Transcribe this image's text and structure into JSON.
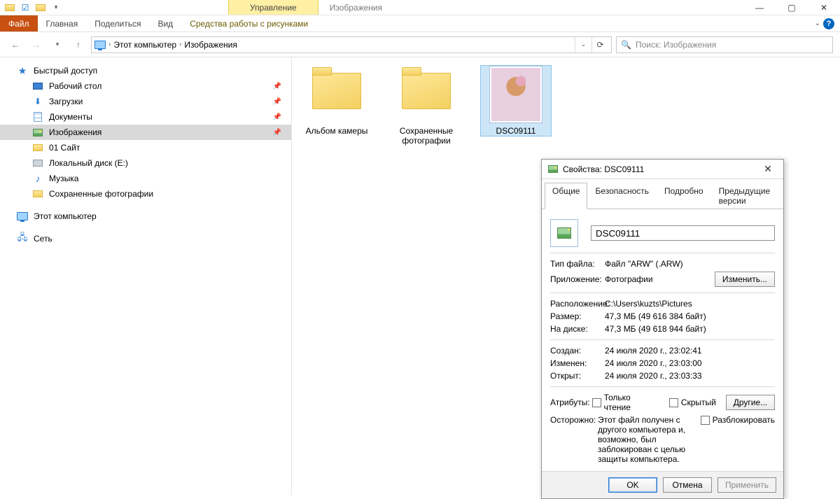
{
  "titlebar": {
    "manage": "Управление",
    "title": "Изображения"
  },
  "ribbon": {
    "file": "Файл",
    "home": "Главная",
    "share": "Поделиться",
    "view": "Вид",
    "picture_tools": "Средства работы с рисунками"
  },
  "breadcrumbs": {
    "this_pc": "Этот компьютер",
    "pictures": "Изображения"
  },
  "search": {
    "placeholder": "Поиск: Изображения"
  },
  "nav": {
    "quick_access": "Быстрый доступ",
    "desktop": "Рабочий стол",
    "downloads": "Загрузки",
    "documents": "Документы",
    "pictures": "Изображения",
    "site01": "01 Сайт",
    "local_disk": "Локальный диск (E:)",
    "music": "Музыка",
    "saved_photos": "Сохраненные фотографии",
    "this_pc": "Этот компьютер",
    "network": "Сеть"
  },
  "items": {
    "camera_roll": "Альбом камеры",
    "saved_photos": "Сохраненные фотографии",
    "dsc": "DSC09111"
  },
  "dialog": {
    "title": "Свойства: DSC09111",
    "tabs": {
      "general": "Общие",
      "security": "Безопасность",
      "details": "Подробно",
      "previous": "Предыдущие версии"
    },
    "filename": "DSC09111",
    "labels": {
      "filetype": "Тип файла:",
      "app": "Приложение:",
      "location": "Расположение:",
      "size": "Размер:",
      "on_disk": "На диске:",
      "created": "Создан:",
      "modified": "Изменен:",
      "accessed": "Открыт:",
      "attributes": "Атрибуты:",
      "caution": "Осторожно:"
    },
    "values": {
      "filetype": "Файл \"ARW\" (.ARW)",
      "app": "Фотографии",
      "location": "C:\\Users\\kuzts\\Pictures",
      "size": "47,3 МБ (49 616 384 байт)",
      "on_disk": "47,3 МБ (49 618 944 байт)",
      "created": "24 июля 2020 г., 23:02:41",
      "modified": "24 июля 2020 г., 23:03:00",
      "accessed": "24 июля 2020 г., 23:03:33",
      "caution_text": "Этот файл получен с другого компьютера и, возможно, был заблокирован с целью защиты компьютера."
    },
    "buttons": {
      "change": "Изменить...",
      "other": "Другие...",
      "readonly": "Только чтение",
      "hidden": "Скрытый",
      "unblock": "Разблокировать",
      "ok": "OK",
      "cancel": "Отмена",
      "apply": "Применить"
    }
  }
}
